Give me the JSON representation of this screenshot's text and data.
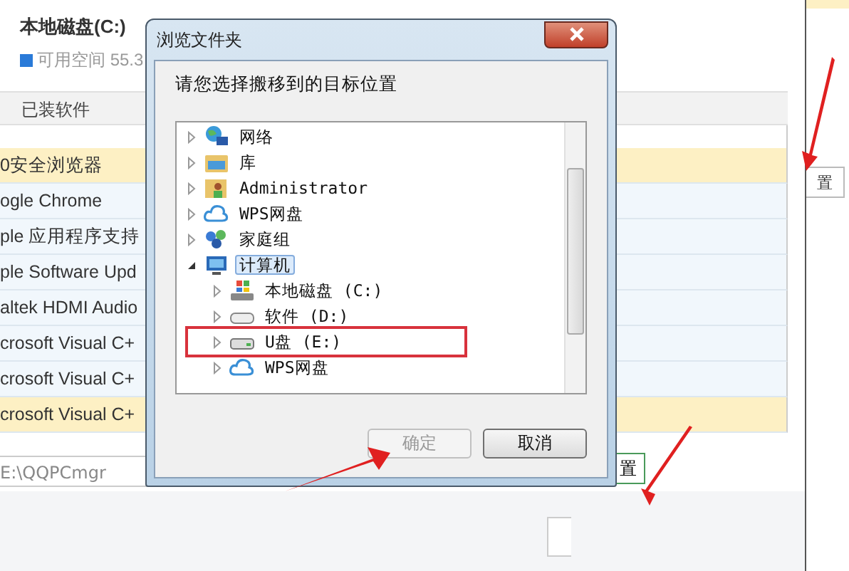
{
  "app": {
    "drive_title": "本地磁盘(C:)",
    "free_space": "可用空间 55.3",
    "column_header": "已装软件",
    "rows": [
      {
        "name": "0安全浏览器",
        "selected": true
      },
      {
        "name": "ogle Chrome",
        "selected": false
      },
      {
        "name": "ple 应用程序支持",
        "selected": false
      },
      {
        "name": "ple Software Upd",
        "selected": false
      },
      {
        "name": "altek HDMI Audio",
        "selected": false
      },
      {
        "name": "crosoft Visual C+",
        "selected": false
      },
      {
        "name": "crosoft Visual C+",
        "selected": false
      },
      {
        "name": "crosoft Visual C+",
        "selected": true
      }
    ],
    "path": "E:\\QQPCmgr",
    "side_button": "置",
    "bottom_button": "置"
  },
  "dialog": {
    "title": "浏览文件夹",
    "prompt": "请您选择搬移到的目标位置",
    "tree": [
      {
        "label": "网络",
        "kind": "network",
        "expanded": false,
        "selected": false
      },
      {
        "label": "库",
        "kind": "library",
        "expanded": false,
        "selected": false
      },
      {
        "label": "Administrator",
        "kind": "user",
        "expanded": false,
        "selected": false
      },
      {
        "label": "WPS网盘",
        "kind": "cloud",
        "expanded": false,
        "selected": false
      },
      {
        "label": "家庭组",
        "kind": "homegroup",
        "expanded": false,
        "selected": false
      },
      {
        "label": "计算机",
        "kind": "computer",
        "expanded": true,
        "selected": true,
        "children": [
          {
            "label": "本地磁盘 (C:)",
            "kind": "system-drive",
            "expanded": false,
            "selected": false
          },
          {
            "label": "软件 (D:)",
            "kind": "drive",
            "expanded": false,
            "selected": false
          },
          {
            "label": "U盘 (E:)",
            "kind": "usb",
            "expanded": false,
            "selected": false
          },
          {
            "label": "WPS网盘",
            "kind": "cloud",
            "expanded": false,
            "selected": false
          }
        ]
      }
    ],
    "buttons": [
      {
        "label": "确定",
        "disabled": true
      },
      {
        "label": "取消",
        "disabled": false
      }
    ]
  }
}
